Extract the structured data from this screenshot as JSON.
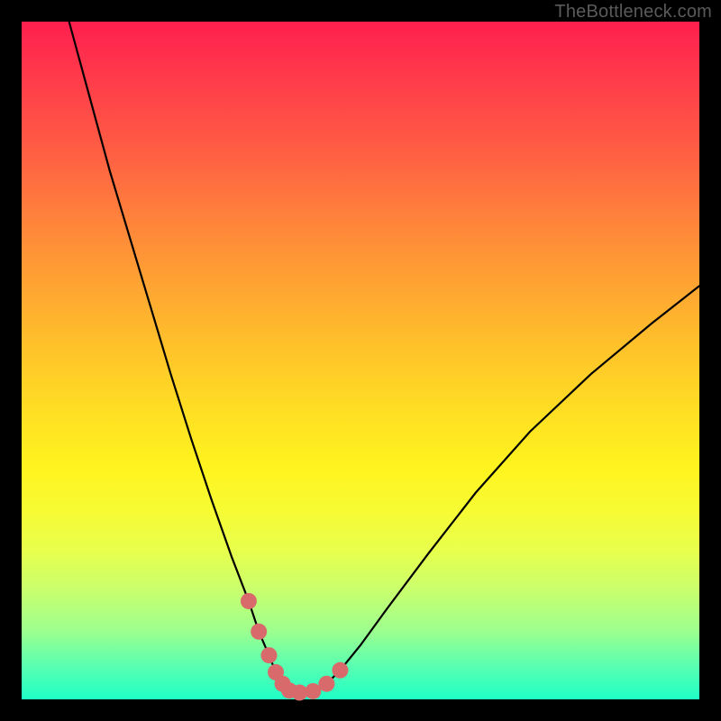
{
  "watermark": "TheBottleneck.com",
  "colors": {
    "frame": "#000000",
    "curve": "#000000",
    "marker": "#d86a6b"
  },
  "chart_data": {
    "type": "line",
    "title": "",
    "xlabel": "",
    "ylabel": "",
    "xlim": [
      0,
      100
    ],
    "ylim": [
      0,
      100
    ],
    "grid": false,
    "legend": false,
    "series": [
      {
        "name": "black-curve",
        "x": [
          7,
          10,
          13,
          16,
          19,
          22,
          25,
          28,
          31,
          33.5,
          35,
          36.5,
          37.5,
          38.5,
          39.5,
          41,
          43,
          45,
          47,
          50,
          54,
          60,
          67,
          75,
          84,
          93,
          100
        ],
        "y": [
          100,
          89,
          78,
          68,
          58,
          48,
          38.5,
          29.5,
          21,
          14.5,
          10,
          6.5,
          4,
          2.3,
          1.3,
          1.0,
          1.2,
          2.3,
          4.3,
          8.0,
          13.5,
          21.5,
          30.5,
          39.5,
          48,
          55.5,
          61
        ]
      }
    ],
    "markers": {
      "name": "bottom-u-highlight",
      "x": [
        33.5,
        35,
        36.5,
        37.5,
        38.5,
        39.5,
        41,
        43,
        45,
        47
      ],
      "y": [
        14.5,
        10,
        6.5,
        4,
        2.3,
        1.3,
        1.0,
        1.2,
        2.3,
        4.3
      ]
    }
  }
}
